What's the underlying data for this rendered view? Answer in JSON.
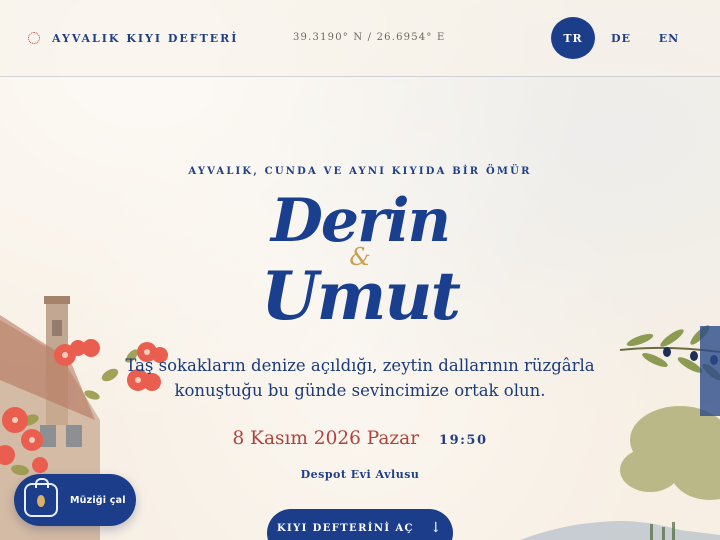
{
  "header": {
    "brand": "AYVALIK KIYI DEFTERİ",
    "brand_icon": "compass-dots-icon",
    "coordinates": "39.3190° N / 26.6954° E",
    "languages": [
      {
        "code": "TR",
        "active": true
      },
      {
        "code": "DE",
        "active": false
      },
      {
        "code": "EN",
        "active": false
      }
    ]
  },
  "hero": {
    "eyebrow": "AYVALIK, CUNDA VE AYNI KIYIDA BİR ÖMÜR",
    "name_one": "Derin",
    "ampersand": "&",
    "name_two": "Umut",
    "message": "Taş sokakların denize açıldığı, zeytin dallarının rüzgârla konuştuğu bu günde sevincimize ortak olun.",
    "date": "8 Kasım 2026 Pazar",
    "time": "19:50",
    "venue": "Despot Evi Avlusu",
    "cta_label": "KIYI DEFTERİNİ AÇ",
    "cta_icon": "arrow-down-icon"
  },
  "music": {
    "label": "Müziği çal",
    "icon": "bag-music-icon"
  },
  "colors": {
    "primary_blue": "#1b3d8a",
    "accent_red": "#b1433d",
    "gold": "#c9a14f",
    "background": "#f8f1e6"
  }
}
